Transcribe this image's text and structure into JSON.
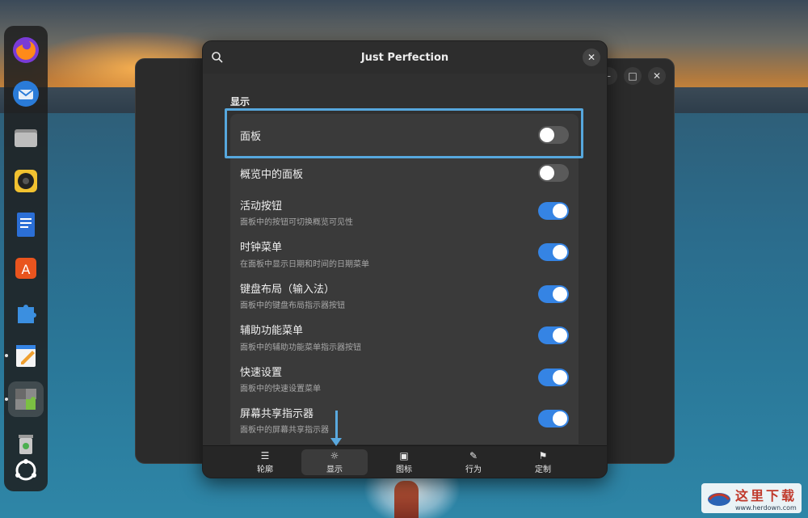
{
  "dialog": {
    "title": "Just Perfection",
    "section_title": "显示",
    "settings": [
      {
        "label": "面板",
        "sub": "",
        "on": false
      },
      {
        "label": "概览中的面板",
        "sub": "",
        "on": false
      },
      {
        "label": "活动按钮",
        "sub": "面板中的按钮可切换概览可见性",
        "on": true
      },
      {
        "label": "时钟菜单",
        "sub": "在面板中显示日期和时间的日期菜单",
        "on": true
      },
      {
        "label": "键盘布局（输入法）",
        "sub": "面板中的键盘布局指示器按钮",
        "on": true
      },
      {
        "label": "辅助功能菜单",
        "sub": "面板中的辅助功能菜单指示器按钮",
        "on": true
      },
      {
        "label": "快速设置",
        "sub": "面板中的快速设置菜单",
        "on": true
      },
      {
        "label": "屏幕共享指示器",
        "sub": "面板中的屏幕共享指示器",
        "on": true
      }
    ],
    "nav": [
      {
        "label": "轮廓",
        "icon": "list-icon"
      },
      {
        "label": "显示",
        "icon": "sun-icon",
        "active": true
      },
      {
        "label": "图标",
        "icon": "image-icon"
      },
      {
        "label": "行为",
        "icon": "wrench-icon"
      },
      {
        "label": "定制",
        "icon": "brush-icon"
      }
    ]
  },
  "watermark": {
    "text": "这里下载",
    "url": "www.herdown.com"
  },
  "colors": {
    "accent": "#3584e4",
    "highlight": "#56a7dd"
  }
}
